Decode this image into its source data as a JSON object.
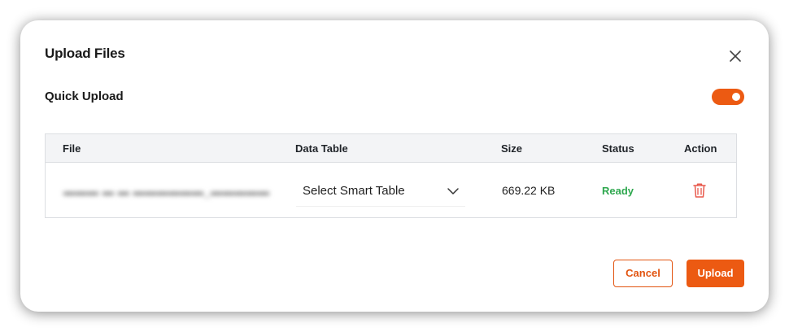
{
  "modal": {
    "title": "Upload Files",
    "close_icon": "close-icon"
  },
  "quick_upload": {
    "label": "Quick Upload",
    "enabled": true,
    "accent_color": "#ec5a12"
  },
  "table": {
    "headers": {
      "file": "File",
      "data_table": "Data Table",
      "size": "Size",
      "status": "Status",
      "action": "Action"
    },
    "rows": [
      {
        "file": "",
        "data_table_placeholder": "Select Smart Table",
        "size": "669.22 KB",
        "status": "Ready",
        "status_color": "#2fa84f",
        "action_icon": "trash-icon"
      }
    ]
  },
  "footer": {
    "cancel_label": "Cancel",
    "upload_label": "Upload"
  }
}
